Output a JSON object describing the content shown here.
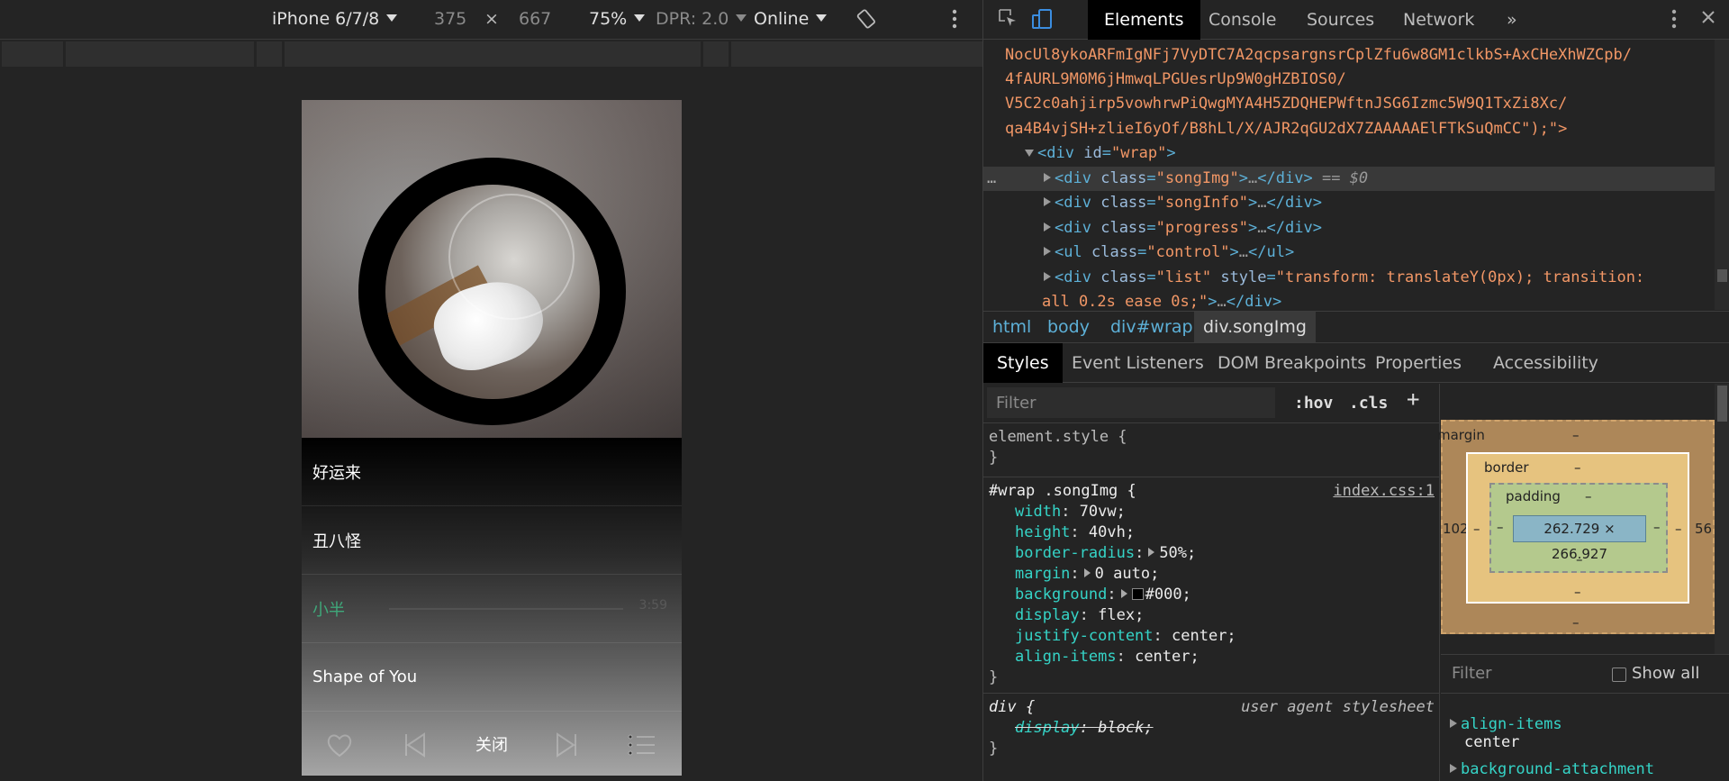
{
  "device_toolbar": {
    "device": "iPhone 6/7/8",
    "width": "375",
    "x": "×",
    "height": "667",
    "zoom": "75%",
    "dpr": "DPR: 2.0",
    "network": "Online"
  },
  "phone": {
    "songs": [
      {
        "title": "好运来",
        "active": false
      },
      {
        "title": "丑八怪",
        "active": false
      },
      {
        "title": "小半",
        "active": true,
        "time": "3:59"
      },
      {
        "title": "Shape of You",
        "active": false
      }
    ],
    "close_label": "关闭",
    "controls": [
      "heart-icon",
      "previous-icon",
      "pause-icon",
      "next-icon",
      "list-icon"
    ]
  },
  "devtools": {
    "tabs": [
      "Elements",
      "Console",
      "Sources",
      "Network"
    ],
    "more_tabs": "»",
    "dom": {
      "base64_lines": [
        "NocUl8ykoARFmIgNFj7VyDTC7A2qcpsargnsrCplZfu6w8GM1clkbS+AxCHeXhWZCpb/",
        "4fAURL9M0M6jHmwqLPGUesrUp9W0gHZBIOS0/",
        "V5C2c0ahjirp5vowhrwPiQwgMYA4H5ZDQHEPWftnJSG6Izmc5W9Q1TxZi8Xc/",
        "qa4B4vjSH+zlieI6yOf/B8hLl/X/AJR2qGU2dX7ZAAAAAElFTkSuQmCC\");\">"
      ],
      "wrap_open": "<div id=\"wrap\">",
      "wrap_tag": "div",
      "wrap_attr": "id",
      "wrap_val": "\"wrap\"",
      "children": [
        {
          "tag": "div",
          "attr": "class",
          "val": "\"songImg\"",
          "selected": true,
          "suffix": "== $0"
        },
        {
          "tag": "div",
          "attr": "class",
          "val": "\"songInfo\"",
          "selected": false
        },
        {
          "tag": "div",
          "attr": "class",
          "val": "\"progress\"",
          "selected": false
        },
        {
          "tag": "ul",
          "attr": "class",
          "val": "\"control\"",
          "selected": false
        },
        {
          "tag": "div",
          "attr": "class",
          "val": "\"list\"",
          "attr2": "style",
          "val2": "\"transform: translateY(0px); transition:",
          "selected": false
        }
      ],
      "list_style_cont": "all 0.2s ease 0s;\"",
      "ellipsis": "…",
      "dots": "…"
    },
    "breadcrumbs": [
      "html",
      "body",
      "div#wrap",
      "div.songImg"
    ],
    "subtabs": [
      "Styles",
      "Event Listeners",
      "DOM Breakpoints",
      "Properties",
      "Accessibility"
    ],
    "styles": {
      "filter_placeholder": "Filter",
      "hov": ":hov",
      "cls": ".cls",
      "plus": "+",
      "element_style": "element.style {",
      "close_brace": "}",
      "rule_selector": "#wrap .songImg {",
      "rule_source": "index.css:1",
      "props": [
        {
          "name": "width",
          "value": "70vw;"
        },
        {
          "name": "height",
          "value": "40vh;"
        },
        {
          "name": "border-radius",
          "value": "50%;",
          "expand": true
        },
        {
          "name": "margin",
          "value": "0 auto;",
          "expand": true
        },
        {
          "name": "background",
          "value": "#000;",
          "expand": true,
          "swatch": true
        },
        {
          "name": "display",
          "value": "flex;"
        },
        {
          "name": "justify-content",
          "value": "center;"
        },
        {
          "name": "align-items",
          "value": "center;"
        }
      ],
      "ua_selector": "div {",
      "ua_source": "user agent stylesheet",
      "ua_prop_name": "display",
      "ua_prop_value": "block;"
    },
    "boxmodel": {
      "margin_label": "margin",
      "border_label": "border",
      "padding_label": "padding",
      "content_size": "262.729 × 266.927",
      "dash": "–",
      "margin_left": "102",
      "margin_right": "56"
    },
    "computed": {
      "filter_placeholder": "Filter",
      "show_all": "Show all",
      "props": [
        {
          "name": "align-items",
          "value": "center"
        },
        {
          "name": "background-attachment",
          "value": ""
        }
      ]
    }
  },
  "colors": {
    "accent_green": "#3fa87a",
    "tag_blue": "#5db0d7",
    "string_orange": "#f29766",
    "prop_cyan": "#35d4c7"
  }
}
